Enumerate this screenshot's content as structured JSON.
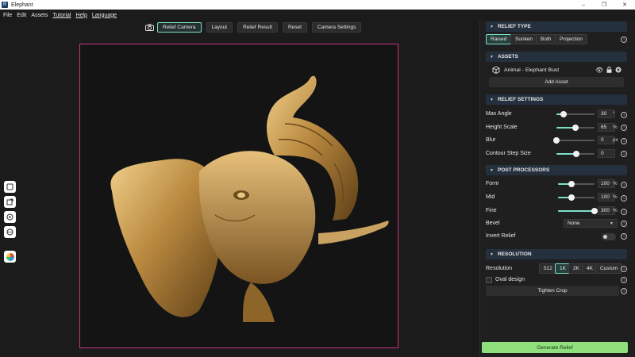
{
  "window": {
    "title": "Elephant",
    "logo_text": "R",
    "controls": [
      "–",
      "❐",
      "✕"
    ]
  },
  "menu": [
    "File",
    "Edit",
    "Assets",
    "Tutorial",
    "Help",
    "Language"
  ],
  "toolbar": {
    "buttons": [
      {
        "label": "Relief Camera",
        "active": true
      },
      {
        "label": "Layout",
        "active": false
      },
      {
        "label": "Relief Result",
        "active": false
      },
      {
        "label": "Reset",
        "active": false
      },
      {
        "label": "Camera Settings",
        "active": false
      }
    ]
  },
  "panel": {
    "relief_type": {
      "title": "RELIEF TYPE",
      "options": [
        "Raised",
        "Sunken",
        "Both",
        "Projection"
      ],
      "selected": "Raised"
    },
    "assets": {
      "title": "ASSETS",
      "items": [
        {
          "name": "Animal - Elephant Bust"
        }
      ],
      "add_label": "Add Asset"
    },
    "relief_settings": {
      "title": "RELIEF SETTINGS",
      "rows": [
        {
          "label": "Max Angle",
          "value": "30",
          "unit": "°",
          "fraction": 0.18
        },
        {
          "label": "Height Scale",
          "value": "65",
          "unit": "%",
          "fraction": 0.5
        },
        {
          "label": "Blur",
          "value": "0",
          "unit": "px",
          "fraction": 0.0
        },
        {
          "label": "Contour Step Size",
          "value": "0",
          "unit": "",
          "fraction": 0.52
        }
      ]
    },
    "post_processors": {
      "title": "POST PROCESSORS",
      "rows": [
        {
          "label": "Form",
          "value": "100",
          "unit": "%",
          "fraction": 0.36
        },
        {
          "label": "Mid",
          "value": "100",
          "unit": "%",
          "fraction": 0.36
        },
        {
          "label": "Fine",
          "value": "300",
          "unit": "%",
          "fraction": 1.0
        }
      ],
      "bevel_label": "Bevel",
      "bevel_value": "None",
      "invert_label": "Invert Relief",
      "invert_on": false
    },
    "resolution": {
      "title": "RESOLUTION",
      "label": "Resolution",
      "options": [
        "512",
        "1K",
        "2K",
        "4K",
        "Custom"
      ],
      "selected": "1K",
      "oval_label": "Oval design",
      "tighten_label": "Tighten Crop"
    },
    "generate_label": "Generate Relief"
  },
  "colors": {
    "accent": "#7de0c8",
    "frame": "#c8327a",
    "generate": "#8fe07c",
    "section": "#25303e"
  }
}
